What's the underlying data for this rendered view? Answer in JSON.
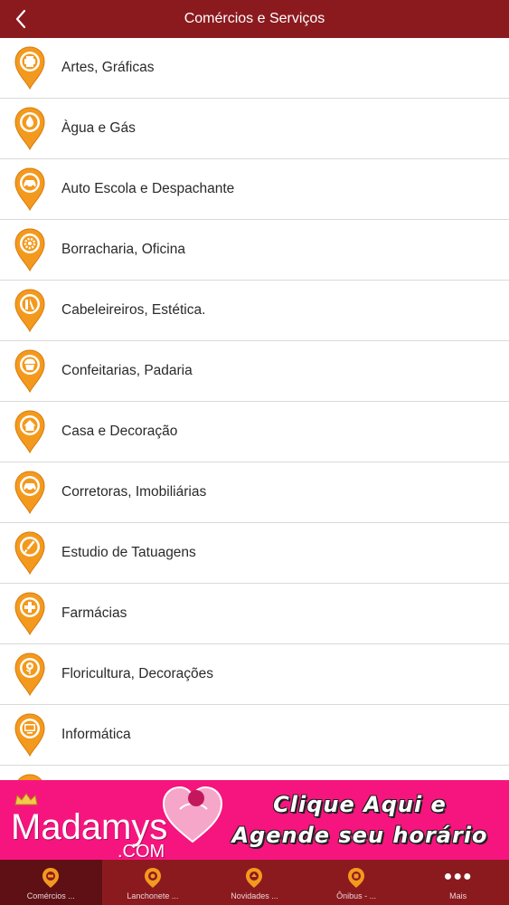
{
  "header": {
    "title": "Comércios e Serviços"
  },
  "categories": [
    {
      "label": "Artes, Gráficas",
      "icon": "printer-icon"
    },
    {
      "label": "Àgua e Gás",
      "icon": "water-drop-icon"
    },
    {
      "label": "Auto Escola e Despachante",
      "icon": "car-icon"
    },
    {
      "label": "Borracharia, Oficina",
      "icon": "gear-icon"
    },
    {
      "label": "Cabeleireiros, Estética.",
      "icon": "hair-salon-icon"
    },
    {
      "label": "Confeitarias, Padaria",
      "icon": "cupcake-icon"
    },
    {
      "label": "Casa e Decoração",
      "icon": "house-icon"
    },
    {
      "label": "Corretoras, Imobiliárias",
      "icon": "car-icon"
    },
    {
      "label": "Estudio de Tatuagens",
      "icon": "brush-icon"
    },
    {
      "label": "Farmácias",
      "icon": "medical-cross-icon"
    },
    {
      "label": "Floricultura, Decorações",
      "icon": "flower-icon"
    },
    {
      "label": "Informática",
      "icon": "monitor-icon"
    }
  ],
  "banner": {
    "brand": "Madamys",
    "brand_suffix": ".COM",
    "cta_line1": "Clique Aqui e",
    "cta_line2": "Agende seu horário"
  },
  "tabs": [
    {
      "label": "Comércios ...",
      "icon": "pin-icon"
    },
    {
      "label": "Lanchonete ...",
      "icon": "pin-icon"
    },
    {
      "label": "Novidades ...",
      "icon": "pin-icon"
    },
    {
      "label": "Ônibus - ...",
      "icon": "pin-icon"
    },
    {
      "label": "Mais",
      "icon": "more-icon"
    }
  ],
  "colors": {
    "header": "#8b1a1f",
    "tab_active": "#5e1014",
    "pin": "#f39a1e",
    "banner": "#f6157f"
  }
}
